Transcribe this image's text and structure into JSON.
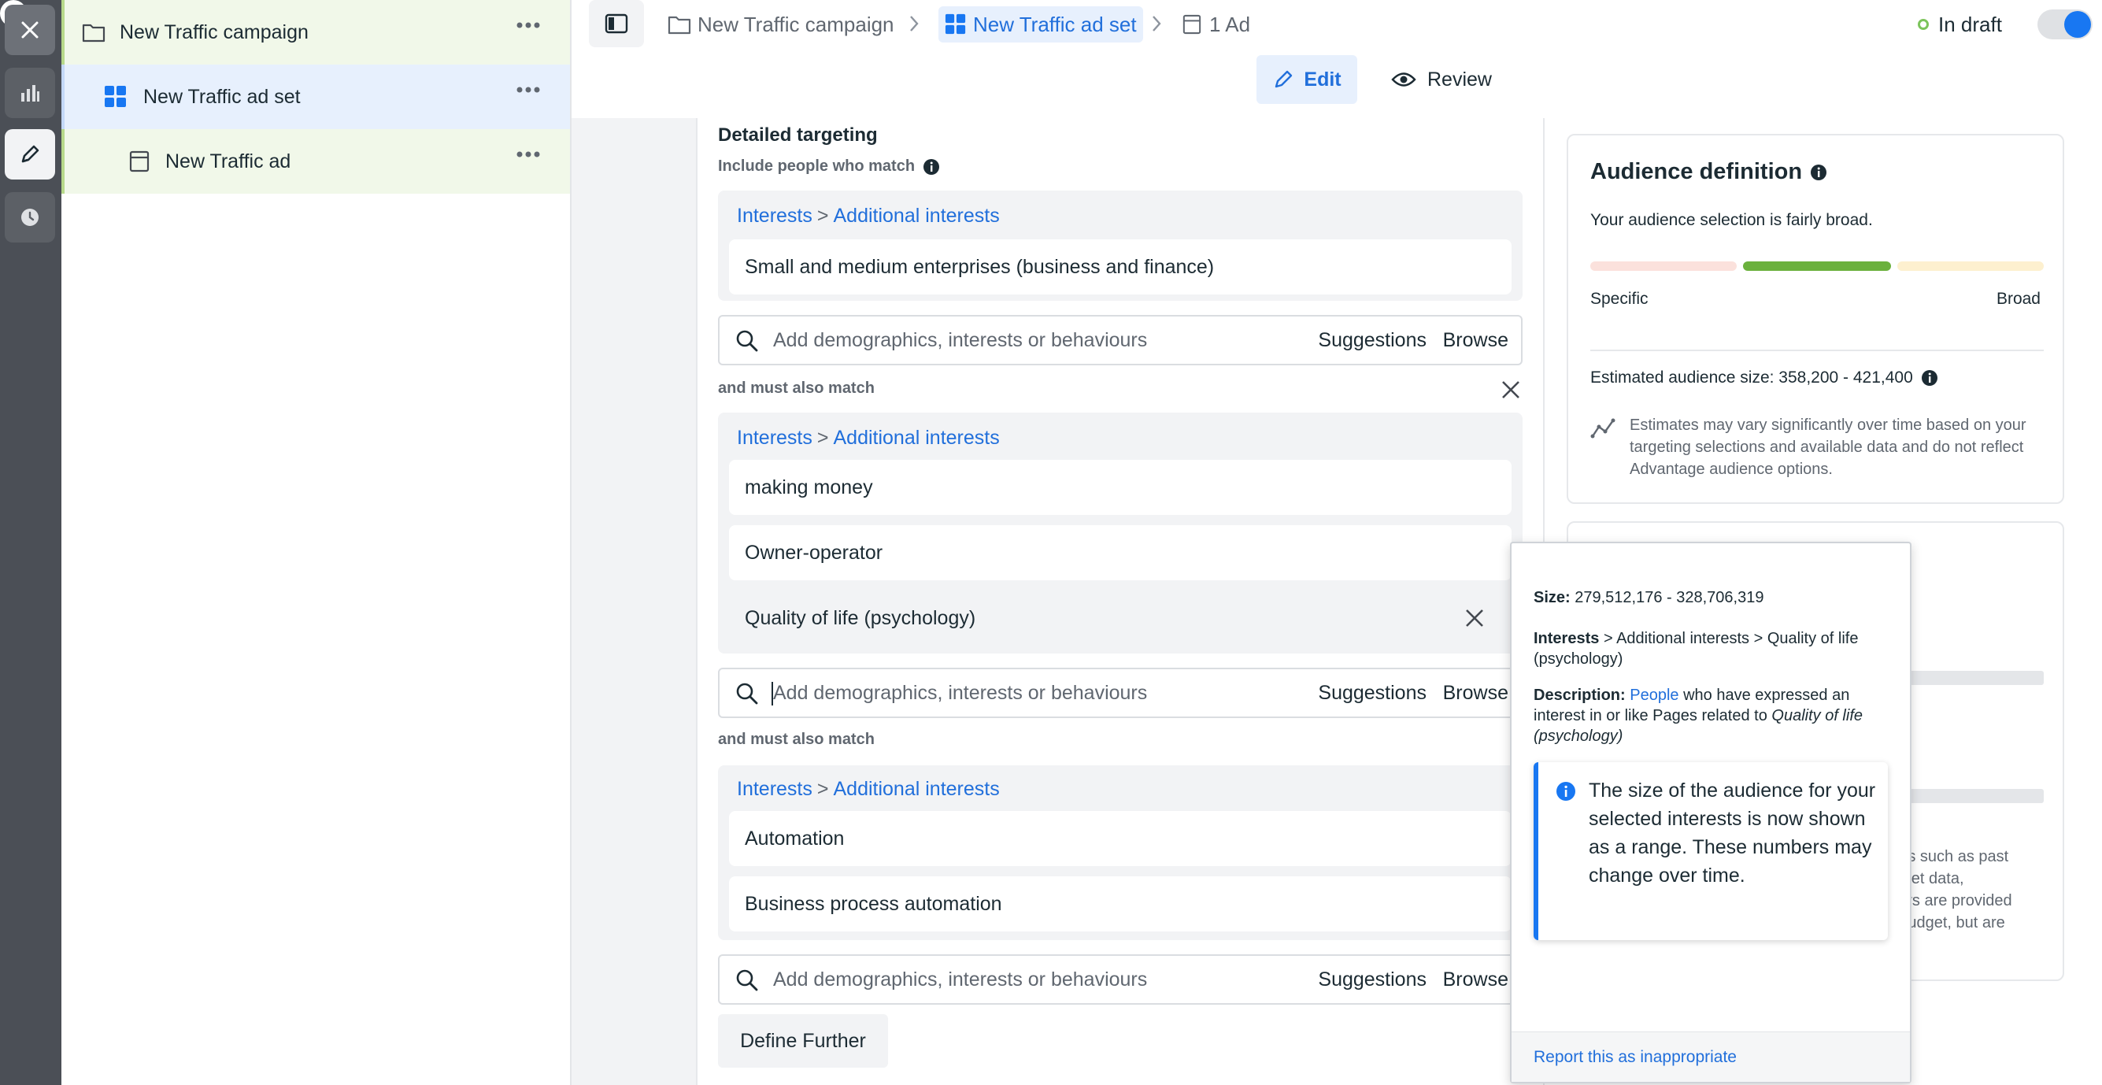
{
  "tree": {
    "campaign": "New Traffic campaign",
    "adset": "New Traffic ad set",
    "ad": "New Traffic ad"
  },
  "breadcrumb": {
    "campaign": "New Traffic campaign",
    "adset": "New Traffic ad set",
    "ad": "1 Ad"
  },
  "status": {
    "label": "In draft"
  },
  "modes": {
    "edit": "Edit",
    "review": "Review"
  },
  "targeting": {
    "title": "Detailed targeting",
    "include_label": "Include people who match",
    "and_label_1": "and must also match",
    "and_label_2": "and must also match",
    "group1": {
      "category": "Interests",
      "subcategory": "Additional interests",
      "items": [
        "Small and medium enterprises (business and finance)"
      ]
    },
    "group2": {
      "category": "Interests",
      "subcategory": "Additional interests",
      "items": [
        "making money",
        "Owner-operator",
        "Quality of life (psychology)"
      ]
    },
    "group3": {
      "category": "Interests",
      "subcategory": "Additional interests",
      "items": [
        "Automation",
        "Business process automation"
      ]
    },
    "search_placeholder": "Add demographics, interests or behaviours",
    "suggestions": "Suggestions",
    "browse": "Browse",
    "define_further": "Define Further"
  },
  "audience": {
    "title": "Audience definition",
    "summary": "Your audience selection is fairly broad.",
    "specific": "Specific",
    "broad": "Broad",
    "estimated_label": "Estimated audience size: 358,200 - 421,400",
    "note": "Estimates may vary significantly over time based on your targeting selections and available data and do not reflect Advantage audience options.",
    "meter_level": "fairly broad"
  },
  "card2": {
    "line1": "tors such as past",
    "line2": "arket data,",
    "line3": "bers are provided",
    "line4": "r budget, but are"
  },
  "popover": {
    "size_label": "Size:",
    "size_value": "279,512,176 - 328,706,319",
    "path_bold": "Interests",
    "path_rest": "> Additional interests > Quality of life (psychology)",
    "desc_label": "Description:",
    "desc_link": "People",
    "desc_text": "who have expressed an interest in or like Pages related to",
    "desc_italic": "Quality of life (psychology)",
    "note": "The size of the audience for your selected interests is now shown as a range. These numbers may change over time.",
    "report": "Report this as inappropriate"
  },
  "colors": {
    "accent": "#216fdb",
    "toggle": "#1877f2",
    "meter_green": "#6bb13d",
    "meter_red": "#fbe1dc",
    "meter_yellow": "#fdf0cf",
    "status_dot": "#7cc45b"
  }
}
